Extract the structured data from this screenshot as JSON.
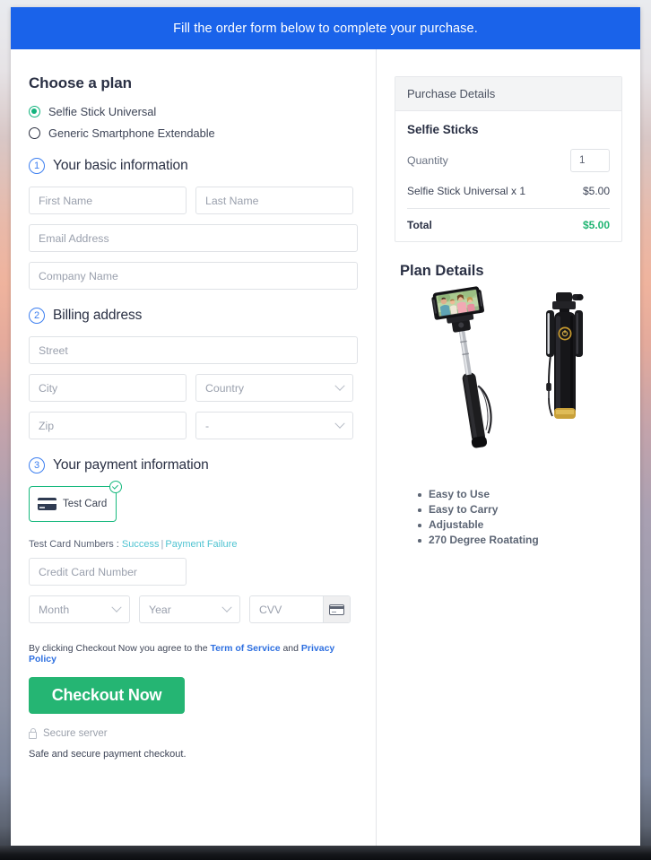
{
  "banner": {
    "text": "Fill the order form below to complete your purchase."
  },
  "plan": {
    "title": "Choose a plan",
    "options": [
      {
        "label": "Selfie Stick Universal",
        "selected": true
      },
      {
        "label": "Generic Smartphone Extendable",
        "selected": false
      }
    ]
  },
  "steps": {
    "basic": {
      "number": "1",
      "title": "Your basic information"
    },
    "billing": {
      "number": "2",
      "title": "Billing address"
    },
    "payment": {
      "number": "3",
      "title": "Your payment information"
    }
  },
  "fields": {
    "first_name": "First Name",
    "last_name": "Last Name",
    "email": "Email Address",
    "company": "Company Name",
    "street": "Street",
    "city": "City",
    "country": "Country",
    "zip": "Zip",
    "state": "-",
    "credit_card": "Credit Card Number",
    "month": "Month",
    "year": "Year",
    "cvv": "CVV"
  },
  "payment": {
    "tile_label": "Test Card",
    "testcards_prefix": "Test Card Numbers : ",
    "success_link": "Success",
    "separator": "|",
    "failure_link": "Payment Failure"
  },
  "terms": {
    "prefix": "By clicking Checkout Now you agree to the ",
    "tos": "Term of Service",
    "and": " and ",
    "privacy": "Privacy Policy"
  },
  "actions": {
    "checkout": "Checkout Now",
    "secure_server": "Secure server",
    "safe_note": "Safe and secure payment checkout."
  },
  "purchase": {
    "header": "Purchase Details",
    "product": "Selfie Sticks",
    "quantity_label": "Quantity",
    "quantity_value": "1",
    "line_item": "Selfie Stick Universal x 1",
    "line_price": "$5.00",
    "total_label": "Total",
    "total_price": "$5.00"
  },
  "plan_details": {
    "title": "Plan Details",
    "features": [
      "Easy to Use",
      "Easy to Carry",
      "Adjustable",
      "270 Degree Roatating"
    ]
  },
  "colors": {
    "banner_blue": "#1a63ea",
    "accent_green": "#25b573",
    "radio_green": "#13b37d",
    "step_blue": "#3d7ff0",
    "link_blue": "#2d6fe0",
    "link_teal": "#4fc3d1"
  }
}
